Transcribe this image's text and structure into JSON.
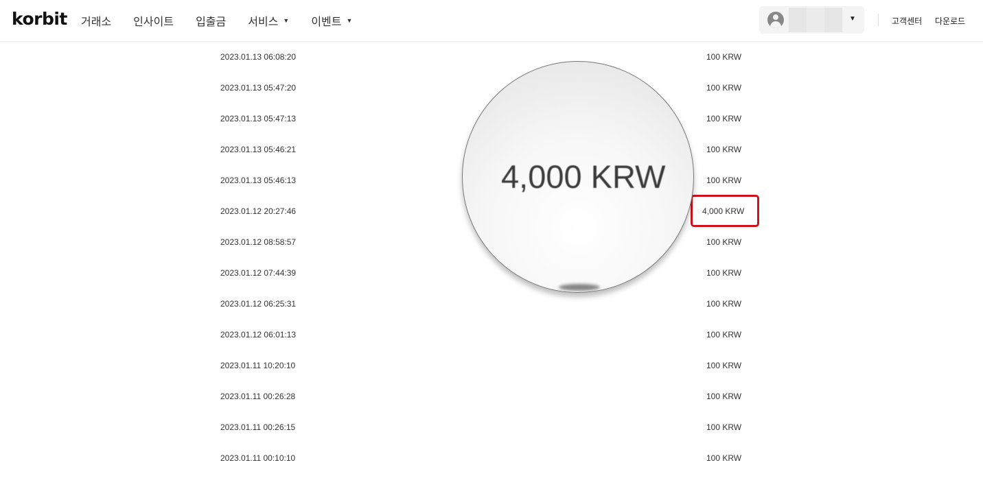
{
  "header": {
    "logo": "korbit",
    "nav": [
      {
        "label": "거래소",
        "caret": false
      },
      {
        "label": "인사이트",
        "caret": false
      },
      {
        "label": "입출금",
        "caret": false
      },
      {
        "label": "서비스",
        "caret": true
      },
      {
        "label": "이벤트",
        "caret": true
      }
    ],
    "caret_glyph": "▼",
    "links": {
      "support": "고객센터",
      "download": "다운로드"
    }
  },
  "rows": [
    {
      "date": "2023.01.13 06:08:20",
      "amount": "100 KRW"
    },
    {
      "date": "2023.01.13 05:47:20",
      "amount": "100 KRW"
    },
    {
      "date": "2023.01.13 05:47:13",
      "amount": "100 KRW"
    },
    {
      "date": "2023.01.13 05:46:21",
      "amount": "100 KRW"
    },
    {
      "date": "2023.01.13 05:46:13",
      "amount": "100 KRW"
    },
    {
      "date": "2023.01.12 20:27:46",
      "amount": "4,000 KRW",
      "highlighted": true
    },
    {
      "date": "2023.01.12 08:58:57",
      "amount": "100 KRW"
    },
    {
      "date": "2023.01.12 07:44:39",
      "amount": "100 KRW"
    },
    {
      "date": "2023.01.12 06:25:31",
      "amount": "100 KRW"
    },
    {
      "date": "2023.01.12 06:01:13",
      "amount": "100 KRW"
    },
    {
      "date": "2023.01.11 10:20:10",
      "amount": "100 KRW"
    },
    {
      "date": "2023.01.11 00:26:28",
      "amount": "100 KRW"
    },
    {
      "date": "2023.01.11 00:26:15",
      "amount": "100 KRW"
    },
    {
      "date": "2023.01.11 00:10:10",
      "amount": "100 KRW"
    }
  ],
  "magnifier": {
    "text": "4,000 KRW"
  },
  "colors": {
    "highlight": "#d0111b"
  }
}
